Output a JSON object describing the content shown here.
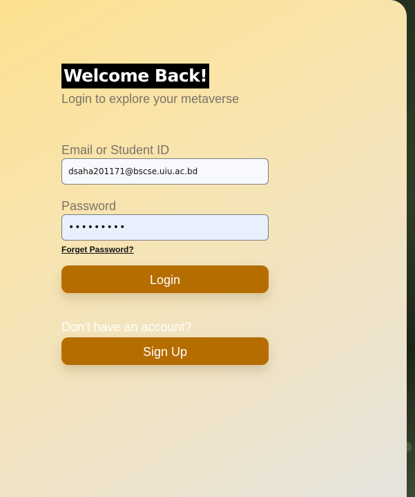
{
  "login": {
    "title": "Welcome Back!",
    "subtitle": "Login to explore your metaverse",
    "email_label": "Email or Student ID",
    "email_value": "dsaha201171@bscse.uiu.ac.bd",
    "password_label": "Password",
    "password_value": "*********",
    "forget_password": "Forget Password?",
    "login_button": "Login",
    "signup_prompt": "Don't have an account?",
    "signup_button": "Sign Up"
  },
  "colors": {
    "button": "#b56d00",
    "title_bg": "#000000",
    "panel_start": "#fde08f",
    "panel_end": "#e6e3dd"
  }
}
